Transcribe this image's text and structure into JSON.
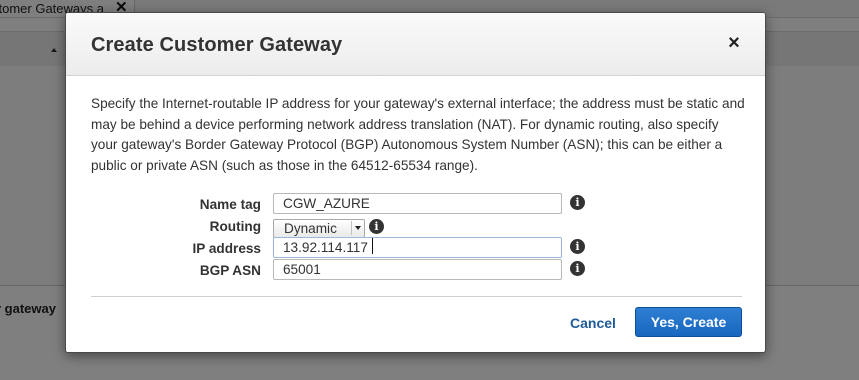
{
  "background": {
    "tab_label": "stomer Gateways a",
    "tab_close_icon": "close-icon",
    "side_label": "r gateway"
  },
  "modal": {
    "title": "Create Customer Gateway",
    "close_symbol": "×",
    "description": "Specify the Internet-routable IP address for your gateway's external interface; the address must be static and may be behind a device performing network address translation (NAT). For dynamic routing, also specify your gateway's Border Gateway Protocol (BGP) Autonomous System Number (ASN); this can be either a public or private ASN (such as those in the 64512-65534 range).",
    "fields": {
      "name_tag": {
        "label": "Name tag",
        "value": "CGW_AZURE"
      },
      "routing": {
        "label": "Routing",
        "value": "Dynamic"
      },
      "ip_address": {
        "label": "IP address",
        "value": "13.92.114.117"
      },
      "bgp_asn": {
        "label": "BGP ASN",
        "value": "65001"
      }
    },
    "info_symbol": "i",
    "cancel_label": "Cancel",
    "create_label": "Yes, Create"
  },
  "colors": {
    "primary_button": "#1f72c9",
    "link": "#1f5b99",
    "overlay": "rgba(0,0,0,0.5)"
  }
}
